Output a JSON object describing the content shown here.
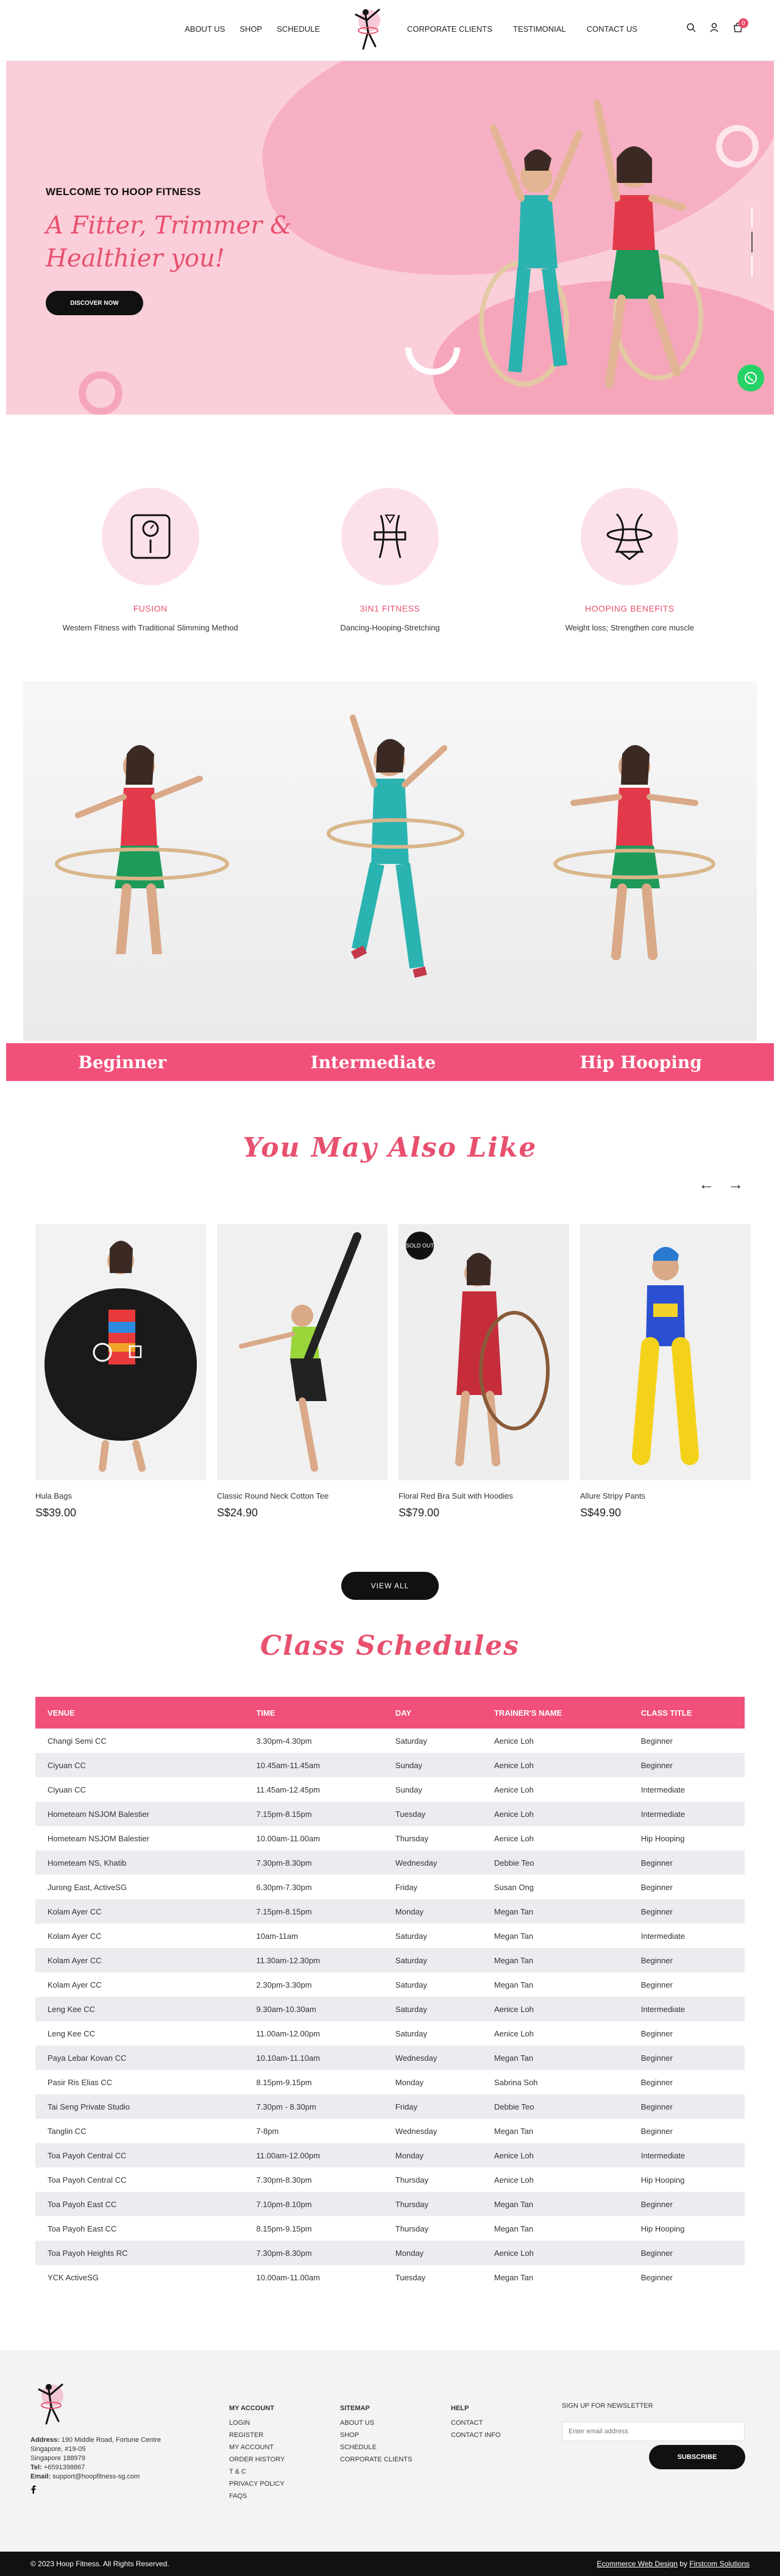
{
  "nav": {
    "left": [
      "ABOUT US",
      "SHOP",
      "SCHEDULE"
    ],
    "right": [
      "CORPORATE CLIENTS",
      "TESTIMONIAL",
      "CONTACT US"
    ],
    "cart_count": "0"
  },
  "hero": {
    "welcome": "WELCOME TO HOOP FITNESS",
    "title_line1": "A Fitter, Trimmer &",
    "title_line2": "Healthier you!",
    "button": "DISCOVER NOW"
  },
  "features": [
    {
      "title": "FUSION",
      "desc": "Western Fitness with Traditional Slimming Method",
      "icon": "scale-icon"
    },
    {
      "title": "3IN1 FITNESS",
      "desc": "Dancing-Hooping-Stretching",
      "icon": "waist-icon"
    },
    {
      "title": "HOOPING BENEFITS",
      "desc": "Weight loss; Strengthen core muscle",
      "icon": "hoop-waist-icon"
    }
  ],
  "levels": [
    "Beginner",
    "Intermediate",
    "Hip Hooping"
  ],
  "also_like": {
    "title": "You May Also Like",
    "products": [
      {
        "name": "Hula Bags",
        "price": "S$39.00"
      },
      {
        "name": "Classic Round Neck Cotton Tee",
        "price": "S$24.90"
      },
      {
        "name": "Floral Red Bra Suit with Hoodies",
        "price": "S$79.00",
        "badge": "SOLD OUT"
      },
      {
        "name": "Allure Stripy Pants",
        "price": "S$49.90"
      }
    ],
    "view_all": "VIEW ALL"
  },
  "schedules": {
    "title": "Class Schedules",
    "headers": [
      "VENUE",
      "TIME",
      "DAY",
      "TRAINER'S NAME",
      "CLASS TITLE"
    ],
    "rows": [
      [
        "Changi Semi CC",
        "3.30pm-4.30pm",
        "Saturday",
        "Aenice Loh",
        "Beginner"
      ],
      [
        "Ciyuan CC",
        "10.45am-11.45am",
        "Sunday",
        "Aenice Loh",
        "Beginner"
      ],
      [
        "Ciyuan CC",
        "11.45am-12.45pm",
        "Sunday",
        "Aenice Loh",
        "Intermediate"
      ],
      [
        "Hometeam NSJOM Balestier",
        "7.15pm-8.15pm",
        "Tuesday",
        "Aenice Loh",
        "Intermediate"
      ],
      [
        "Hometeam NSJOM Balestier",
        "10.00am-11.00am",
        "Thursday",
        "Aenice Loh",
        "Hip Hooping"
      ],
      [
        "Hometeam NS, Khatib",
        "7.30pm-8.30pm",
        "Wednesday",
        "Debbie Teo",
        "Beginner"
      ],
      [
        "Jurong East, ActiveSG",
        "6.30pm-7.30pm",
        "Friday",
        "Susan Ong",
        "Beginner"
      ],
      [
        "Kolam Ayer CC",
        "7.15pm-8.15pm",
        "Monday",
        "Megan Tan",
        "Beginner"
      ],
      [
        "Kolam Ayer CC",
        "10am-11am",
        "Saturday",
        "Megan Tan",
        "Intermediate"
      ],
      [
        "Kolam Ayer CC",
        "11.30am-12.30pm",
        "Saturday",
        "Megan Tan",
        "Beginner"
      ],
      [
        "Kolam Ayer CC",
        "2.30pm-3.30pm",
        "Saturday",
        "Megan Tan",
        "Beginner"
      ],
      [
        "Leng Kee CC",
        "9.30am-10.30am",
        "Saturday",
        "Aenice Loh",
        "Intermediate"
      ],
      [
        "Leng Kee CC",
        "11.00am-12.00pm",
        "Saturday",
        "Aenice Loh",
        "Beginner"
      ],
      [
        "Paya Lebar Kovan CC",
        "10.10am-11.10am",
        "Wednesday",
        "Megan Tan",
        "Beginner"
      ],
      [
        "Pasir Ris Elias CC",
        "8.15pm-9.15pm",
        "Monday",
        "Sabrina Soh",
        "Beginner"
      ],
      [
        "Tai Seng Private Studio",
        "7.30pm - 8.30pm",
        "Friday",
        "Debbie Teo",
        "Beginner"
      ],
      [
        "Tanglin CC",
        "7-8pm",
        "Wednesday",
        "Megan Tan",
        "Beginner"
      ],
      [
        "Toa Payoh Central CC",
        "11.00am-12.00pm",
        "Monday",
        "Aenice Loh",
        "Intermediate"
      ],
      [
        "Toa Payoh Central CC",
        "7.30pm-8.30pm",
        "Thursday",
        "Aenice Loh",
        "Hip Hooping"
      ],
      [
        "Toa Payoh East CC",
        "7.10pm-8.10pm",
        "Thursday",
        "Megan Tan",
        "Beginner"
      ],
      [
        "Toa Payoh East CC",
        "8.15pm-9.15pm",
        "Thursday",
        "Megan Tan",
        "Hip Hooping"
      ],
      [
        "Toa Payoh Heights RC",
        "7.30pm-8.30pm",
        "Monday",
        "Aenice Loh",
        "Beginner"
      ],
      [
        "YCK ActiveSG",
        "10.00am-11.00am",
        "Tuesday",
        "Megan Tan",
        "Beginner"
      ]
    ]
  },
  "footer": {
    "address_label": "Address:",
    "address": "190 Middle Road, Fortune Centre",
    "address2": "Singapore, #19-05",
    "address3": "Singapore 188979",
    "tel_label": "Tel:",
    "tel": "+6591398867",
    "email_label": "Email:",
    "email": "support@hoopfitness-sg.com",
    "my_account": {
      "title": "MY ACCOUNT",
      "items": [
        "LOGIN",
        "REGISTER",
        "MY ACCOUNT",
        "ORDER HISTORY",
        "T & C",
        "PRIVACY POLICY",
        "FAQS"
      ]
    },
    "sitemap": {
      "title": "SITEMAP",
      "items": [
        "ABOUT US",
        "SHOP",
        "SCHEDULE",
        "CORPORATE CLIENTS"
      ]
    },
    "help": {
      "title": "HELP",
      "items": [
        "CONTACT",
        "CONTACT INFO"
      ]
    },
    "newsletter_title": "SIGN UP FOR NEWSLETTER",
    "newsletter_placeholder": "Enter email address",
    "subscribe": "SUBSCRIBE",
    "copyright": "© 2023 Hoop Fitness. All Rights Reserved.",
    "credit_link": "Ecommerce Web Design",
    "credit_by": "by",
    "credit_company": "Firstcom Solutions"
  }
}
